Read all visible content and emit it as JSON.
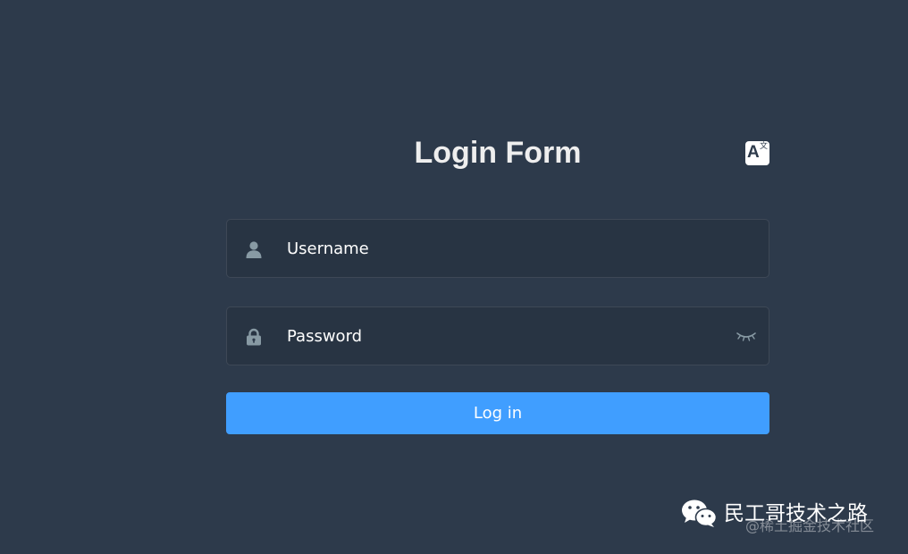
{
  "login_form": {
    "title": "Login Form",
    "language_icon": "translate-icon",
    "language_icon_glyph_main": "A",
    "language_icon_glyph_sub": "文",
    "username": {
      "icon": "user-icon",
      "placeholder": "Username",
      "value": ""
    },
    "password": {
      "icon": "lock-icon",
      "placeholder": "Password",
      "value": "",
      "toggle_icon": "eye-closed-icon"
    },
    "login_button_label": "Log in"
  },
  "watermark": {
    "icon": "wechat-icon",
    "main_text": "民工哥技术之路",
    "sub_text": "@稀土掘金技术社区"
  },
  "colors": {
    "background": "#2d3a4b",
    "title_text": "#eeeeee",
    "input_text": "#ffffff",
    "icon": "#889aa4",
    "button_bg": "#409eff",
    "button_text": "#ffffff"
  }
}
